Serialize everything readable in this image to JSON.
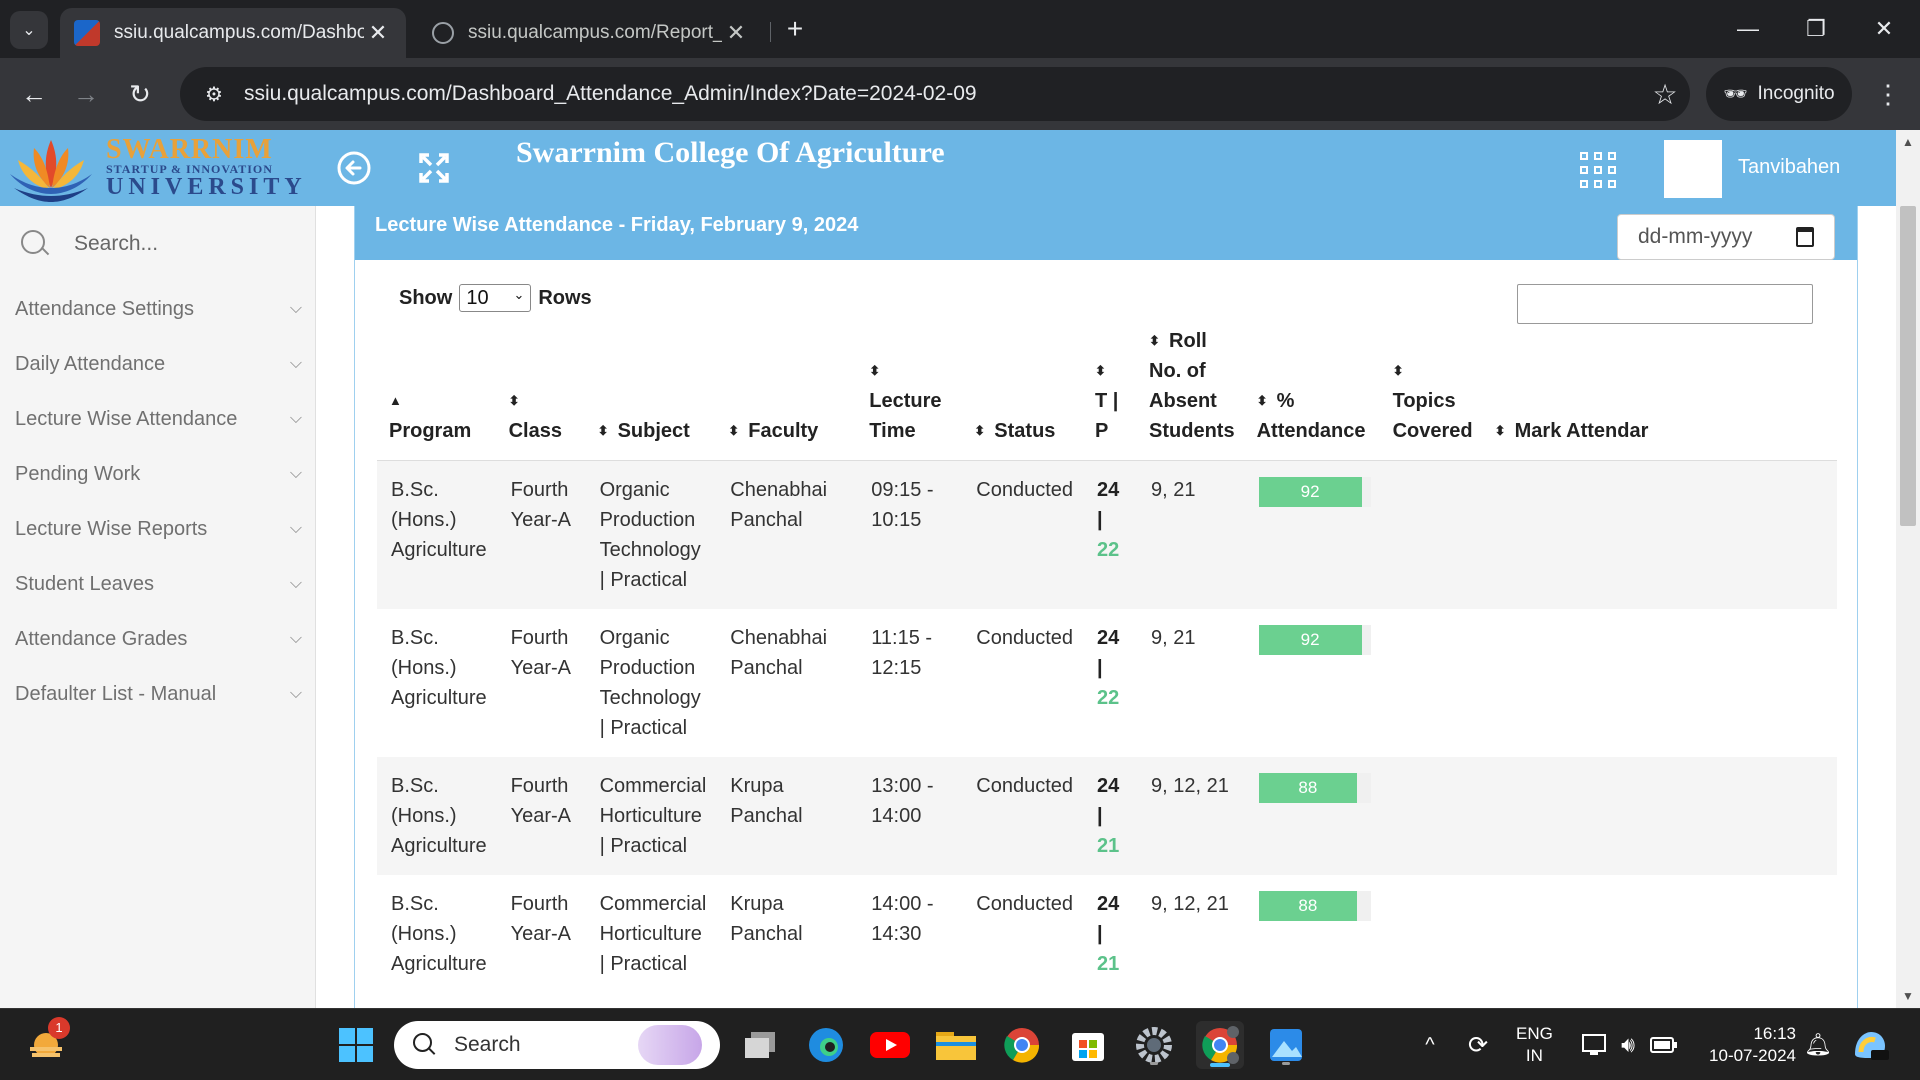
{
  "browser": {
    "tabs": [
      {
        "title": "ssiu.qualcampus.com/Dashboar",
        "active": true
      },
      {
        "title": "ssiu.qualcampus.com/Report_Vi",
        "active": false
      }
    ],
    "url": "ssiu.qualcampus.com/Dashboard_Attendance_Admin/Index?Date=2024-02-09",
    "profile_label": "Incognito"
  },
  "header": {
    "logo": {
      "line1": "SWARRNIM",
      "line2": "STARTUP & INNOVATION",
      "line3": "UNIVERSITY"
    },
    "college_title": "Swarrnim College Of Agriculture",
    "user_name": "Tanvibahen",
    "accent_color": "#6cb6e5"
  },
  "sidebar": {
    "search_placeholder": "Search...",
    "items": [
      {
        "label": "Attendance Settings"
      },
      {
        "label": "Daily Attendance"
      },
      {
        "label": "Lecture Wise Attendance"
      },
      {
        "label": "Pending Work"
      },
      {
        "label": "Lecture Wise Reports"
      },
      {
        "label": "Student Leaves"
      },
      {
        "label": "Attendance Grades"
      },
      {
        "label": "Defaulter List - Manual"
      }
    ]
  },
  "main": {
    "panel_title": "Lecture Wise Attendance - Friday, February 9, 2024",
    "date_placeholder": "dd-mm-yyyy",
    "show_label": "Show",
    "rows_label": "Rows",
    "page_size": "10",
    "table": {
      "columns": [
        {
          "label": "Program",
          "sort": "asc"
        },
        {
          "label": "Class",
          "sort": "both"
        },
        {
          "label": "Subject",
          "sort": "both"
        },
        {
          "label": "Faculty",
          "sort": "both"
        },
        {
          "label": "Lecture Time",
          "sort": "both"
        },
        {
          "label": "Status",
          "sort": "both"
        },
        {
          "label": "T | P",
          "sort": "both"
        },
        {
          "label": "Roll No. of Absent Students",
          "sort": "both"
        },
        {
          "label": "% Attendance",
          "sort": "both"
        },
        {
          "label": "Topics Covered",
          "sort": "both"
        },
        {
          "label": "Mark Attendar",
          "sort": "both"
        }
      ],
      "rows": [
        {
          "program": "B.Sc. (Hons.) Agriculture",
          "class": "Fourth Year-A",
          "subject": "Organic Production Technology | Practical",
          "faculty": "Chenabhai Panchal",
          "time": "09:15 - 10:15",
          "status": "Conducted",
          "t": "24",
          "p": "22",
          "absent": "9, 21",
          "attendance": 92,
          "topics": ""
        },
        {
          "program": "B.Sc. (Hons.) Agriculture",
          "class": "Fourth Year-A",
          "subject": "Organic Production Technology | Practical",
          "faculty": "Chenabhai Panchal",
          "time": "11:15 - 12:15",
          "status": "Conducted",
          "t": "24",
          "p": "22",
          "absent": "9, 21",
          "attendance": 92,
          "topics": ""
        },
        {
          "program": "B.Sc. (Hons.) Agriculture",
          "class": "Fourth Year-A",
          "subject": "Commercial Horticulture | Practical",
          "faculty": "Krupa Panchal",
          "time": "13:00 - 14:00",
          "status": "Conducted",
          "t": "24",
          "p": "21",
          "absent": "9, 12, 21",
          "attendance": 88,
          "topics": ""
        },
        {
          "program": "B.Sc. (Hons.) Agriculture",
          "class": "Fourth Year-A",
          "subject": "Commercial Horticulture | Practical",
          "faculty": "Krupa Panchal",
          "time": "14:00 - 14:30",
          "status": "Conducted",
          "t": "24",
          "p": "21",
          "absent": "9, 12, 21",
          "attendance": 88,
          "topics": ""
        }
      ]
    }
  },
  "taskbar": {
    "search_placeholder": "Search",
    "weather_badge": "1",
    "lang_line1": "ENG",
    "lang_line2": "IN",
    "time": "16:13",
    "date": "10-07-2024"
  }
}
